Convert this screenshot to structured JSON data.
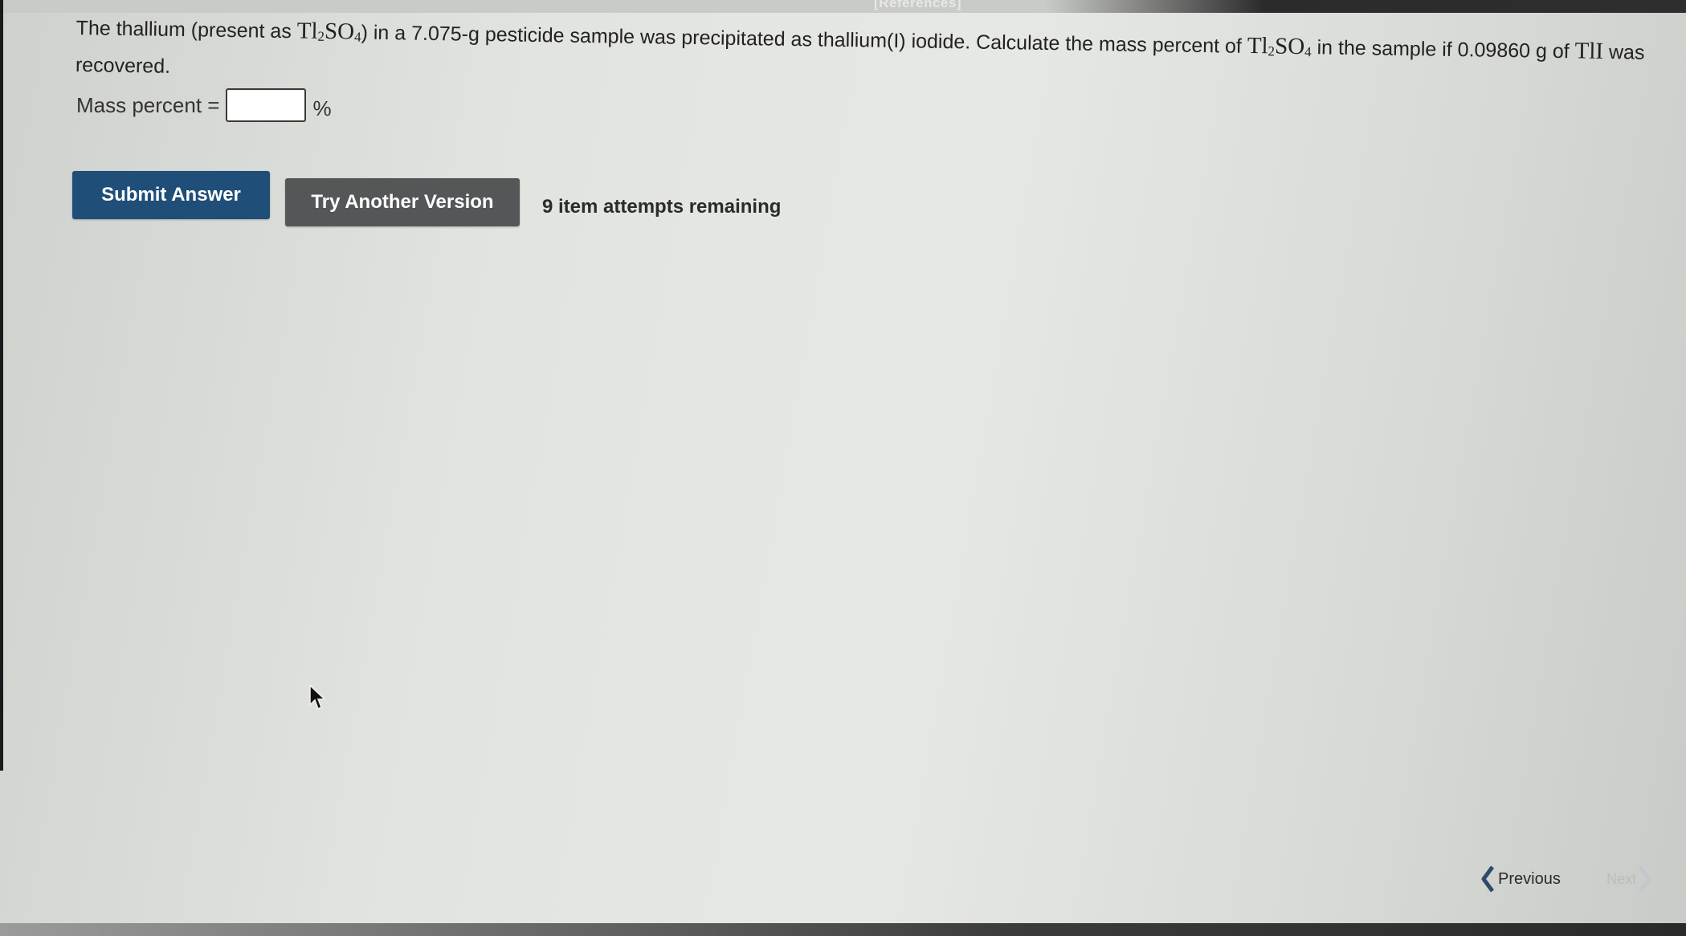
{
  "header": {
    "references_label": "[References]"
  },
  "question": {
    "text_1": "The thallium (present as ",
    "formula_1_base": "Tl",
    "formula_1_sub1": "2",
    "formula_1_mid": "SO",
    "formula_1_sub2": "4",
    "text_2": ") in a 7.075-g pesticide sample was precipitated as thallium(I) iodide. Calculate the mass percent of ",
    "formula_2_base": "Tl",
    "formula_2_sub1": "2",
    "formula_2_mid": "SO",
    "formula_2_sub2": "4",
    "text_3": " in the sample if 0.09860 g of ",
    "formula_3": "TlI",
    "text_4": " was recovered."
  },
  "answer": {
    "label": "Mass percent =",
    "value": "",
    "unit": "%"
  },
  "actions": {
    "submit_label": "Submit Answer",
    "try_another_label": "Try Another Version",
    "attempts_text": "9 item attempts remaining"
  },
  "navigation": {
    "previous_label": "Previous",
    "next_label": "Next"
  },
  "colors": {
    "submit_button": "#1f4e79",
    "try_another_button": "#545658",
    "next_disabled": "#b9bcbf"
  },
  "icons": [
    "cursor-arrow-icon",
    "chevron-left-icon",
    "chevron-right-icon"
  ]
}
